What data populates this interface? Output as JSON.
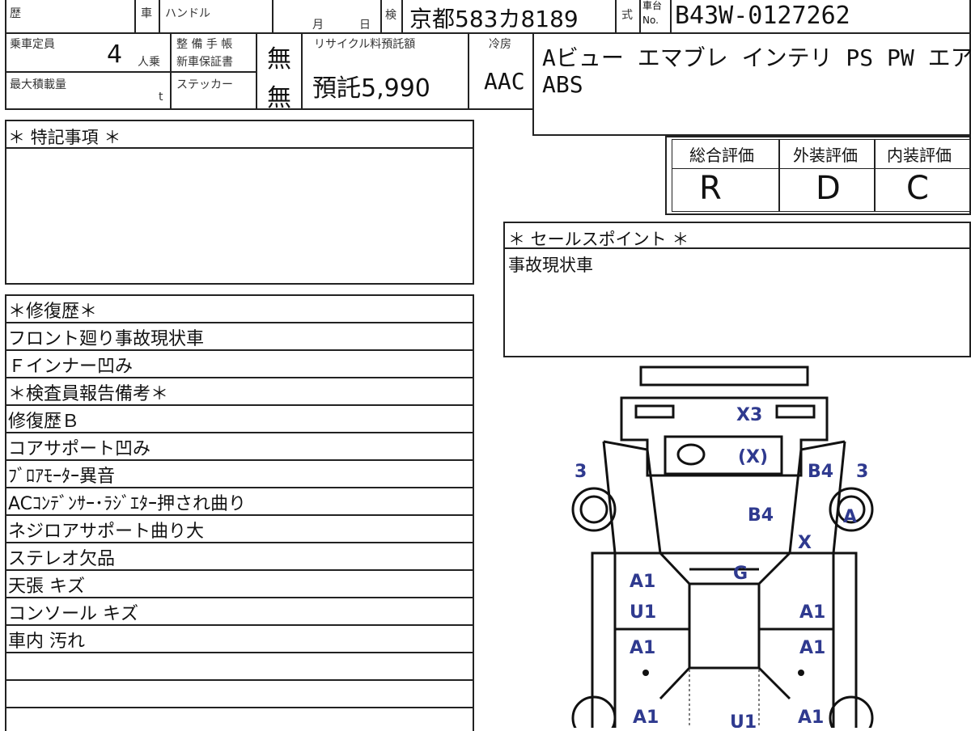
{
  "header": {
    "history_label": "歴",
    "car_label": "車",
    "handle_label": "ハンドル",
    "month_label": "月",
    "day_label": "日",
    "inspection_label": "検",
    "plate": "京都583カ8189",
    "model_label": "式",
    "chassis_label_top": "車台",
    "chassis_label_bottom": "No.",
    "chassis_no": "B43W-0127262"
  },
  "specs": {
    "capacity_label": "乗車定員",
    "capacity_value": "4",
    "capacity_unit": "人乗",
    "maint_label_1": "整 備 手 帳",
    "maint_label_2": "新車保証書",
    "maint_value": "無",
    "recycle_label": "リサイクル料預託額",
    "recycle_value": "預託5,990",
    "ac_label": "冷房",
    "ac_value": "AAC",
    "max_load_label": "最大積載量",
    "max_load_unit": "t",
    "sticker_label": "ステッカー",
    "sticker_value": "無",
    "equipment_line_1": "Aビュー エマブレ インテリ PS PW エアB",
    "equipment_line_2": "ABS"
  },
  "ratings": {
    "overall_label": "総合評価",
    "overall_value": "R",
    "exterior_label": "外装評価",
    "exterior_value": "D",
    "interior_label": "内装評価",
    "interior_value": "C"
  },
  "special_notes": {
    "title": "＊ 特記事項 ＊"
  },
  "sales_point": {
    "title": "＊ セールスポイント ＊",
    "text": "事故現状車"
  },
  "report_rows": [
    "＊修復歴＊",
    "フロント廻り事故現状車",
    "Ｆインナー凹み",
    "＊検査員報告備考＊",
    "修復歴Ｂ",
    "コアサポート凹み",
    "ﾌﾞﾛｱﾓｰﾀｰ異音",
    "ACｺﾝﾃﾞﾝｻｰ･ﾗｼﾞｴﾀｰ押され曲り",
    "ネジロアサポート曲り大",
    "ステレオ欠品",
    "天張 キズ",
    "コンソール キズ",
    "車内 汚れ"
  ],
  "damage_map": {
    "marks": [
      "X3",
      "(X)",
      "3",
      "B4",
      "3",
      "B4",
      "A",
      "X",
      "G",
      "A1",
      "U1",
      "A1",
      "A1",
      "A1",
      "A1",
      "A1",
      "U1"
    ]
  }
}
